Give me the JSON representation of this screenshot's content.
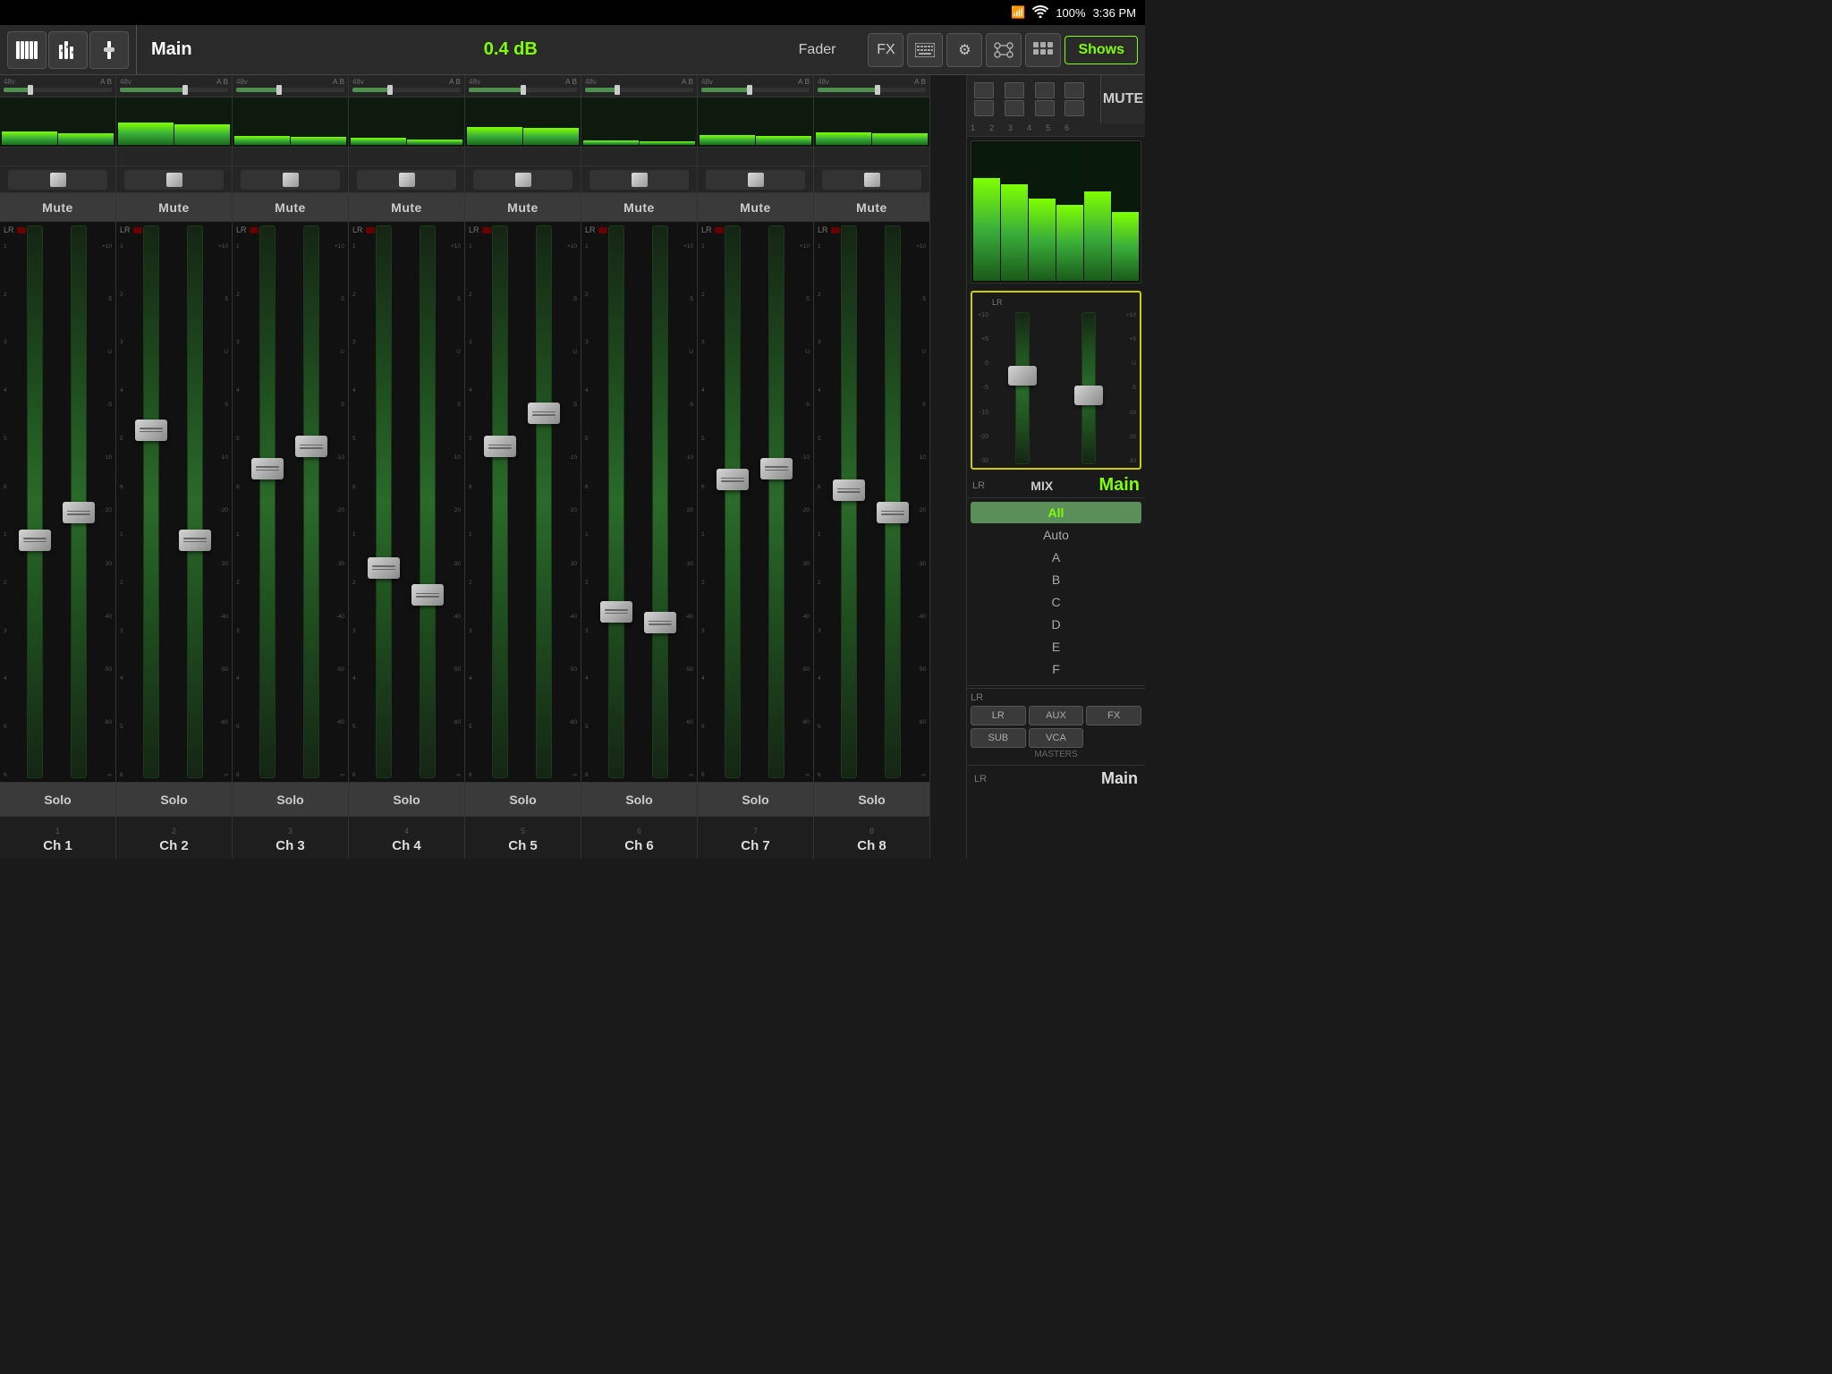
{
  "statusBar": {
    "signal": "📶",
    "wifi": "wifi",
    "battery": "100%",
    "time": "3:36 PM"
  },
  "toolbar": {
    "channelName": "Main",
    "dbValue": "0.4 dB",
    "faderLabel": "Fader",
    "fxLabel": "FX",
    "showsLabel": "Shows",
    "mixerIcon": "mixer",
    "eqIcon": "eq",
    "faderIcon": "fader",
    "settingsIcon": "⚙",
    "routingIcon": "routing",
    "layoutIcon": "layout"
  },
  "channels": [
    {
      "id": 1,
      "name": "Ch 1",
      "gainPct": 25,
      "faderPos1": 55,
      "faderPos2": 50,
      "meter1": 30,
      "meter2": 25
    },
    {
      "id": 2,
      "name": "Ch 2",
      "gainPct": 60,
      "faderPos1": 35,
      "faderPos2": 55,
      "meter1": 50,
      "meter2": 45
    },
    {
      "id": 3,
      "name": "Ch 3",
      "gainPct": 40,
      "faderPos1": 42,
      "faderPos2": 38,
      "meter1": 20,
      "meter2": 18
    },
    {
      "id": 4,
      "name": "Ch 4",
      "gainPct": 35,
      "faderPos1": 60,
      "faderPos2": 65,
      "meter1": 15,
      "meter2": 12
    },
    {
      "id": 5,
      "name": "Ch 5",
      "gainPct": 50,
      "faderPos1": 38,
      "faderPos2": 32,
      "meter1": 40,
      "meter2": 38
    },
    {
      "id": 6,
      "name": "Ch 6",
      "gainPct": 30,
      "faderPos1": 68,
      "faderPos2": 70,
      "meter1": 10,
      "meter2": 8
    },
    {
      "id": 7,
      "name": "Ch 7",
      "gainPct": 45,
      "faderPos1": 44,
      "faderPos2": 42,
      "meter1": 22,
      "meter2": 20
    },
    {
      "id": 8,
      "name": "Ch 8",
      "gainPct": 55,
      "faderPos1": 46,
      "faderPos2": 50,
      "meter1": 28,
      "meter2": 26
    }
  ],
  "rightPanel": {
    "muteLabel": "MUTE",
    "mixLabel": "MIX",
    "lrLabel": "LR",
    "mainLabel": "Main",
    "allLabel": "All",
    "autoLabel": "Auto",
    "aLabel": "A",
    "bLabel": "B",
    "cLabel": "C",
    "dLabel": "D",
    "eLabel": "E",
    "fLabel": "F",
    "lrBottomLabel": "LR",
    "auxLabel": "AUX",
    "fxLabel": "FX",
    "subLabel": "SUB",
    "vcaLabel": "VCA",
    "mastersLabel": "MASTERS",
    "mainBottomLabel": "Main",
    "muteNumbers": [
      "1",
      "2",
      "3",
      "4",
      "5",
      "6"
    ],
    "faderPos1": 35,
    "faderPos2": 48
  },
  "dbMarkers": [
    "+10",
    "+5",
    "0",
    "-5",
    "-10",
    "-20",
    "-30",
    "-40",
    "-50",
    "-60",
    "∞"
  ],
  "labels": {
    "mute": "Mute",
    "solo": "Solo"
  }
}
